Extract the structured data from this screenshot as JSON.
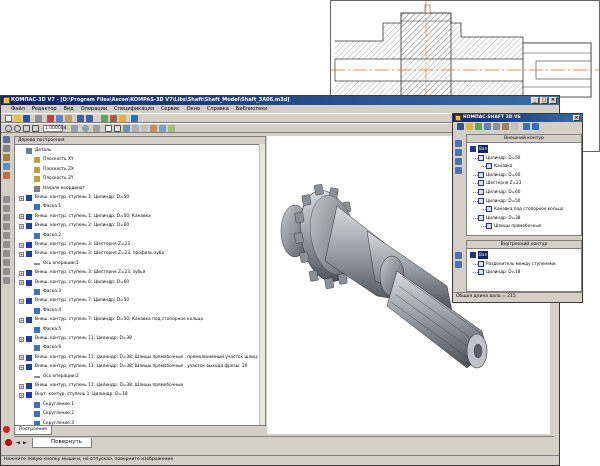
{
  "cad_view": {
    "label": "shaft-drawing"
  },
  "main_window": {
    "title": "КОМПАС-3D V7 - [D:\\Program Files\\Ascon\\KOMPAS-3D V7\\Libs\\Shaft\\Shaft_Model\\Shaft_3A06.m3d]",
    "menu": [
      "Файл",
      "Редактор",
      "Вид",
      "Операции",
      "Спецификация",
      "Сервис",
      "Окно",
      "Справка",
      "Библиотеки"
    ],
    "scale": "1.000004",
    "tree_panel": {
      "title": "Дерево построения",
      "items": [
        {
          "label": "Деталь",
          "indent": 0,
          "exp": "",
          "icon": "part-icon"
        },
        {
          "label": "Плоскость XY",
          "indent": 1,
          "exp": "",
          "icon": "plane-icon"
        },
        {
          "label": "Плоскость ZX",
          "indent": 1,
          "exp": "",
          "icon": "plane-icon"
        },
        {
          "label": "Плоскость ZY",
          "indent": 1,
          "exp": "",
          "icon": "plane-icon"
        },
        {
          "label": "Начало координат",
          "indent": 1,
          "exp": "",
          "icon": "origin-icon"
        },
        {
          "label": "Внеш. контур, ступень 1: Цилиндр: D=50",
          "indent": 0,
          "exp": "+",
          "icon": "shaft-op-icon"
        },
        {
          "label": "Фаска:1",
          "indent": 1,
          "exp": "",
          "icon": "chamfer-icon"
        },
        {
          "label": "Внеш. контур, ступень 1: Цилиндр: D=50; Канавка",
          "indent": 0,
          "exp": "+",
          "icon": "shaft-op-icon"
        },
        {
          "label": "Внеш. контур, ступень 2: Цилиндр: D=60",
          "indent": 0,
          "exp": "+",
          "icon": "shaft-op-icon"
        },
        {
          "label": "Фаска:2",
          "indent": 1,
          "exp": "",
          "icon": "chamfer-icon"
        },
        {
          "label": "Внеш. контур, ступень 3: Шестерня Z=23",
          "indent": 0,
          "exp": "+",
          "icon": "shaft-op-icon"
        },
        {
          "label": "Внеш. контур, ступень 3: Шестерня Z=23, профиль зуба",
          "indent": 0,
          "exp": "+",
          "icon": "shaft-op-icon"
        },
        {
          "label": "Ось операции:1",
          "indent": 1,
          "exp": "",
          "icon": "axis-icon"
        },
        {
          "label": "Внеш. контур, ступень 3: Шестерня Z=23, зубья",
          "indent": 0,
          "exp": "+",
          "icon": "shaft-op-icon"
        },
        {
          "label": "Внеш. контур, ступень 6: Цилиндр: D=60",
          "indent": 0,
          "exp": "+",
          "icon": "shaft-op-icon"
        },
        {
          "label": "Фаска:3",
          "indent": 1,
          "exp": "",
          "icon": "chamfer-icon"
        },
        {
          "label": "Внеш. контур, ступень 7: Цилиндр: D=50",
          "indent": 0,
          "exp": "+",
          "icon": "shaft-op-icon"
        },
        {
          "label": "Фаска:4",
          "indent": 1,
          "exp": "",
          "icon": "chamfer-icon"
        },
        {
          "label": "Внеш. контур, ступень 7: Цилиндр: D=50; Канавка под стопорное кольцо",
          "indent": 0,
          "exp": "+",
          "icon": "shaft-op-icon"
        },
        {
          "label": "Фаска:5",
          "indent": 1,
          "exp": "",
          "icon": "chamfer-icon"
        },
        {
          "label": "Внеш. контур, ступень 11: Цилиндр: D=38",
          "indent": 0,
          "exp": "+",
          "icon": "shaft-op-icon"
        },
        {
          "label": "Фаска:6",
          "indent": 1,
          "exp": "",
          "icon": "chamfer-icon"
        },
        {
          "label": "Внеш. контур, ступень 11: Цилиндр: D=38; Шлицы прямобочные , прямолинейный участок шлиц: 20",
          "indent": 0,
          "exp": "+",
          "icon": "shaft-op-icon"
        },
        {
          "label": "Внеш. контур, ступень 11: Цилиндр: D=38; Шлицы прямобочные , участок выхода фрезы: 20",
          "indent": 0,
          "exp": "+",
          "icon": "shaft-op-icon"
        },
        {
          "label": "Ось операции:2",
          "indent": 1,
          "exp": "",
          "icon": "axis-icon"
        },
        {
          "label": "Внеш. контур, ступень 11: Цилиндр: D=38; Шлицы прямобочные",
          "indent": 0,
          "exp": "+",
          "icon": "shaft-op-icon"
        },
        {
          "label": "Внут. контур, ступень 1: Цилиндр: D=18",
          "indent": 0,
          "exp": "+",
          "icon": "shaft-op-icon"
        },
        {
          "label": "Скругление:1",
          "indent": 1,
          "exp": "",
          "icon": "fillet-icon"
        },
        {
          "label": "Скругление:2",
          "indent": 1,
          "exp": "",
          "icon": "fillet-icon"
        },
        {
          "label": "Скругление:3",
          "indent": 1,
          "exp": "",
          "icon": "fillet-icon"
        }
      ],
      "tab": "Построение"
    },
    "rotate_tab": "Повернуть",
    "status": "Нажмите левую кнопку мыши и, не отпуская, поверните изображение"
  },
  "shaft_window": {
    "title": "КОМПАС-SHAFT 2D V6",
    "outer_header": "Внешний контур",
    "outer_items": [
      {
        "label": "Вал",
        "level": 0,
        "selected": true
      },
      {
        "label": "Цилиндр: D=50",
        "level": 1
      },
      {
        "label": "Канавка",
        "level": 2
      },
      {
        "label": "Цилиндр: D=60",
        "level": 1
      },
      {
        "label": "Шестерня Z=23",
        "level": 1
      },
      {
        "label": "Цилиндр: D=60",
        "level": 1
      },
      {
        "label": "Цилиндр: D=50",
        "level": 1
      },
      {
        "label": "Канавка под стопорное кольцо",
        "level": 2
      },
      {
        "label": "Цилиндр: D=38",
        "level": 1
      },
      {
        "label": "Шлицы прямобочные",
        "level": 2
      }
    ],
    "inner_header": "Внутренний контур",
    "inner_items": [
      {
        "label": "Вал",
        "level": 0,
        "selected": true
      },
      {
        "label": "Разделитель между ступенями",
        "level": 1
      },
      {
        "label": "Цилиндр: D=18",
        "level": 1
      }
    ],
    "status": "Общая длина вала = 215"
  }
}
